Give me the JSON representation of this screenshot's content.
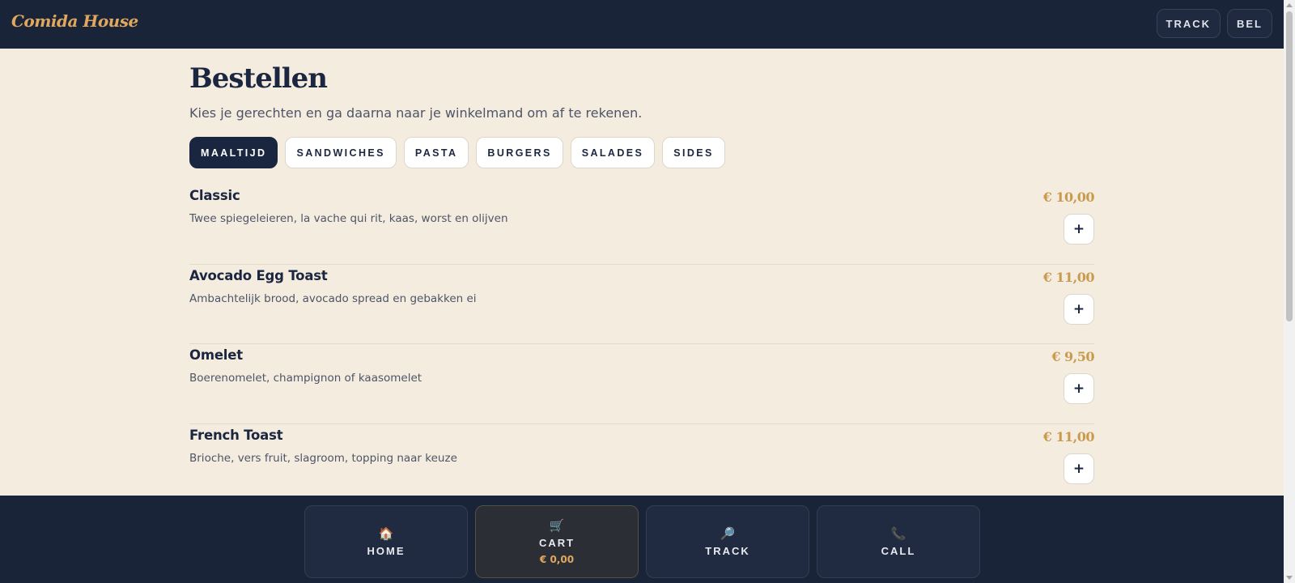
{
  "header": {
    "brand": "Comida House",
    "actions": [
      {
        "label": "TRACK"
      },
      {
        "label": "BEL"
      }
    ]
  },
  "page": {
    "title": "Bestellen",
    "subtitle": "Kies je gerechten en ga daarna naar je winkelmand om af te rekenen."
  },
  "tabs": [
    {
      "label": "MAALTIJD",
      "active": true
    },
    {
      "label": "SANDWICHES"
    },
    {
      "label": "PASTA"
    },
    {
      "label": "BURGERS"
    },
    {
      "label": "SALADES"
    },
    {
      "label": "SIDES"
    }
  ],
  "menu_items": [
    {
      "name": "Classic",
      "description": "Twee spiegeleieren, la vache qui rit, kaas, worst en olijven",
      "price": "€ 10,00",
      "add_label": "+"
    },
    {
      "name": "Avocado Egg Toast",
      "description": "Ambachtelijk brood, avocado spread en gebakken ei",
      "price": "€ 11,00",
      "add_label": "+"
    },
    {
      "name": "Omelet",
      "description": "Boerenomelet, champignon of kaasomelet",
      "price": "€ 9,50",
      "add_label": "+"
    },
    {
      "name": "French Toast",
      "description": "Brioche, vers fruit, slagroom, topping naar keuze",
      "price": "€ 11,00",
      "add_label": "+"
    }
  ],
  "bottom_nav": {
    "home": {
      "icon": "🏠",
      "icon_name": "house-icon",
      "label": "HOME"
    },
    "cart": {
      "icon": "🛒",
      "icon_name": "cart-icon",
      "label": "CART",
      "total": "€ 0,00"
    },
    "track": {
      "icon": "🔎",
      "icon_name": "magnifier-icon",
      "label": "TRACK"
    },
    "call": {
      "icon": "📞",
      "icon_name": "phone-icon",
      "label": "CALL"
    }
  },
  "colors": {
    "navy": "#1a2438",
    "cream": "#f5ece0",
    "gold": "#c99a4d",
    "brand_gold": "#e0a85e"
  }
}
